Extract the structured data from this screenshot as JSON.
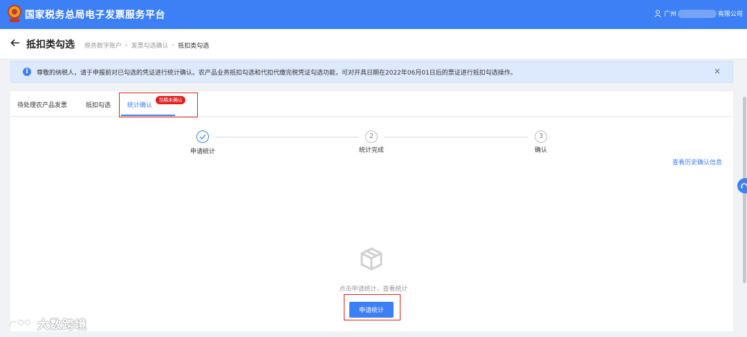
{
  "header": {
    "app_title": "国家税务总局电子发票服务平台",
    "user_prefix": "广州",
    "user_suffix": "有限公司"
  },
  "nav": {
    "page_title": "抵扣类勾选",
    "breadcrumbs": [
      "税务数字账户",
      "发票勾选确认",
      "抵扣类勾选"
    ]
  },
  "notice": {
    "text": "尊敬的纳税人，请于申报前对已勾选的凭证进行统计确认。农产品业务抵扣勾选和代扣代缴完税凭证勾选功能，可对开具日期在2022年06月01日后的票证进行抵扣勾选操作。",
    "close_symbol": "×"
  },
  "tabs": [
    {
      "label": "待处理农产品发票"
    },
    {
      "label": "抵扣勾选"
    },
    {
      "label": "统计确认",
      "badge": "当期未确认",
      "active": true
    }
  ],
  "steps": [
    {
      "label": "申请统计",
      "done": true,
      "number": ""
    },
    {
      "label": "统计完成",
      "done": false,
      "number": "2"
    },
    {
      "label": "确认",
      "done": false,
      "number": "3"
    }
  ],
  "history_link": "查看历史确认信息",
  "empty_state": {
    "text": "点击申请统计，查看统计",
    "button_label": "申请统计"
  },
  "watermark": {
    "text": "大数跨境"
  },
  "colors": {
    "primary": "#3d7ff5",
    "highlight": "#e02020",
    "notice_bg": "#dde9fd"
  }
}
